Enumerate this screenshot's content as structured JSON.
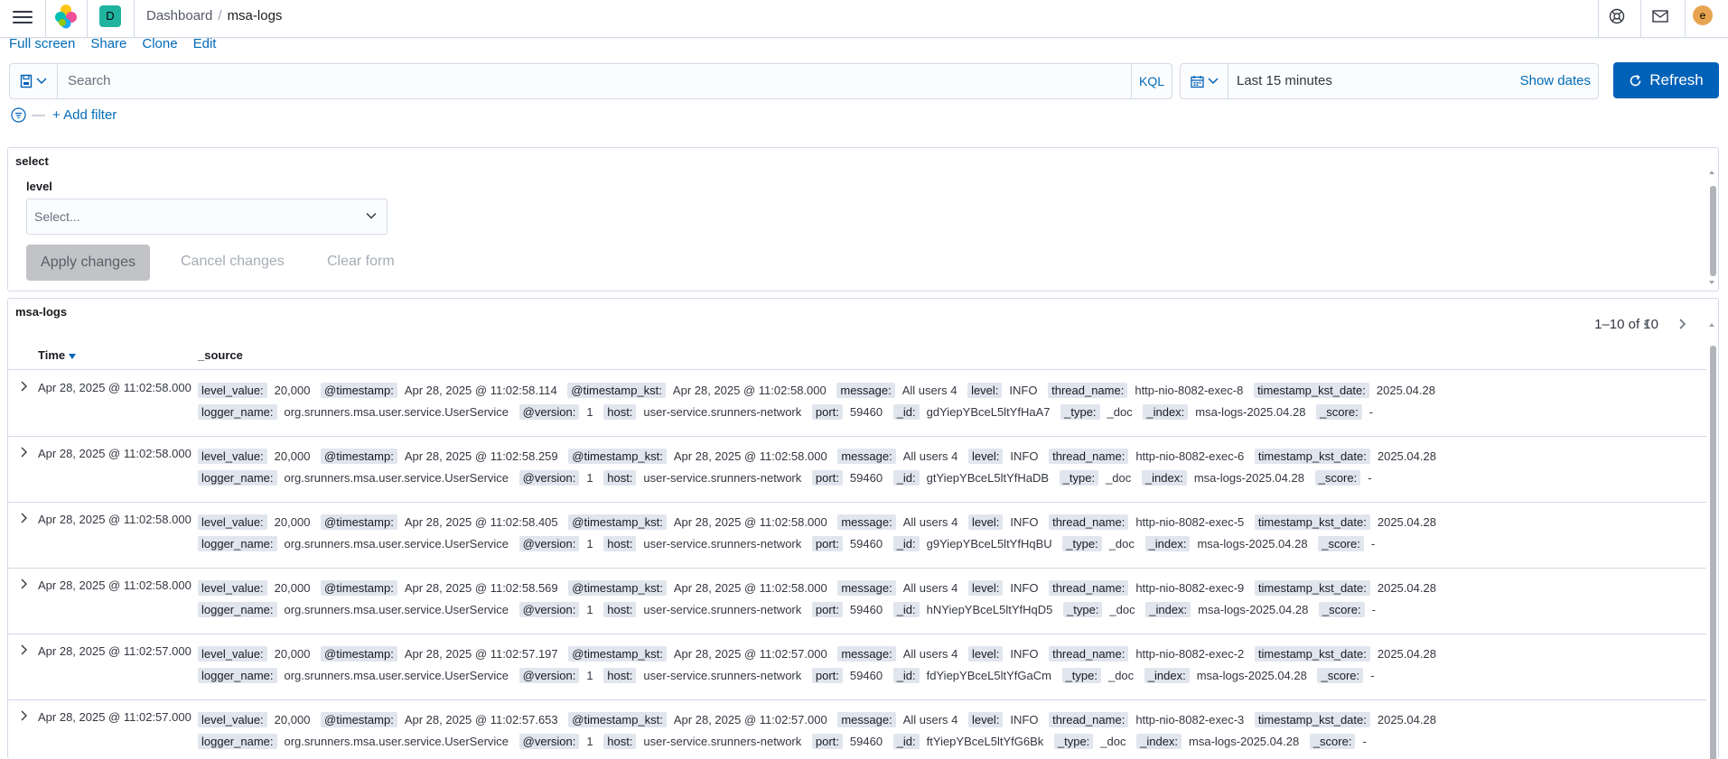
{
  "header": {
    "space_initial": "D",
    "breadcrumb_parent": "Dashboard",
    "breadcrumb_sep": "/",
    "breadcrumb_current": "msa-logs",
    "user_initial": "e"
  },
  "links": [
    "Full screen",
    "Share",
    "Clone",
    "Edit"
  ],
  "query": {
    "search_placeholder": "Search",
    "language": "KQL"
  },
  "time": {
    "range": "Last 15 minutes",
    "show_dates": "Show dates",
    "refresh_label": "Refresh"
  },
  "filter": {
    "add_filter": "+ Add filter"
  },
  "controls_panel": {
    "title": "select",
    "level_label": "level",
    "level_placeholder": "Select...",
    "apply": "Apply changes",
    "cancel": "Cancel changes",
    "clear": "Clear form"
  },
  "search_panel": {
    "title": "msa-logs",
    "pagination": "1–10 of 10",
    "col_time": "Time",
    "col_source": "_source",
    "rows": [
      {
        "time": "Apr 28, 2025 @ 11:02:58.000",
        "fields": [
          {
            "k": "level_value:",
            "v": "20,000"
          },
          {
            "k": "@timestamp:",
            "v": "Apr 28, 2025 @ 11:02:58.114"
          },
          {
            "k": "@timestamp_kst:",
            "v": "Apr 28, 2025 @ 11:02:58.000"
          },
          {
            "k": "message:",
            "v": "All users 4"
          },
          {
            "k": "level:",
            "v": "INFO"
          },
          {
            "k": "thread_name:",
            "v": "http-nio-8082-exec-8"
          },
          {
            "k": "timestamp_kst_date:",
            "v": "2025.04.28"
          },
          {
            "k": "logger_name:",
            "v": "org.srunners.msa.user.service.UserService"
          },
          {
            "k": "@version:",
            "v": "1"
          },
          {
            "k": "host:",
            "v": "user-service.srunners-network"
          },
          {
            "k": "port:",
            "v": "59460"
          },
          {
            "k": "_id:",
            "v": "gdYiepYBceL5ltYfHaA7"
          },
          {
            "k": "_type:",
            "v": "_doc"
          },
          {
            "k": "_index:",
            "v": "msa-logs-2025.04.28"
          },
          {
            "k": "_score:",
            "v": "-"
          }
        ]
      },
      {
        "time": "Apr 28, 2025 @ 11:02:58.000",
        "fields": [
          {
            "k": "level_value:",
            "v": "20,000"
          },
          {
            "k": "@timestamp:",
            "v": "Apr 28, 2025 @ 11:02:58.259"
          },
          {
            "k": "@timestamp_kst:",
            "v": "Apr 28, 2025 @ 11:02:58.000"
          },
          {
            "k": "message:",
            "v": "All users 4"
          },
          {
            "k": "level:",
            "v": "INFO"
          },
          {
            "k": "thread_name:",
            "v": "http-nio-8082-exec-6"
          },
          {
            "k": "timestamp_kst_date:",
            "v": "2025.04.28"
          },
          {
            "k": "logger_name:",
            "v": "org.srunners.msa.user.service.UserService"
          },
          {
            "k": "@version:",
            "v": "1"
          },
          {
            "k": "host:",
            "v": "user-service.srunners-network"
          },
          {
            "k": "port:",
            "v": "59460"
          },
          {
            "k": "_id:",
            "v": "gtYiepYBceL5ltYfHaDB"
          },
          {
            "k": "_type:",
            "v": "_doc"
          },
          {
            "k": "_index:",
            "v": "msa-logs-2025.04.28"
          },
          {
            "k": "_score:",
            "v": "-"
          }
        ]
      },
      {
        "time": "Apr 28, 2025 @ 11:02:58.000",
        "fields": [
          {
            "k": "level_value:",
            "v": "20,000"
          },
          {
            "k": "@timestamp:",
            "v": "Apr 28, 2025 @ 11:02:58.405"
          },
          {
            "k": "@timestamp_kst:",
            "v": "Apr 28, 2025 @ 11:02:58.000"
          },
          {
            "k": "message:",
            "v": "All users 4"
          },
          {
            "k": "level:",
            "v": "INFO"
          },
          {
            "k": "thread_name:",
            "v": "http-nio-8082-exec-5"
          },
          {
            "k": "timestamp_kst_date:",
            "v": "2025.04.28"
          },
          {
            "k": "logger_name:",
            "v": "org.srunners.msa.user.service.UserService"
          },
          {
            "k": "@version:",
            "v": "1"
          },
          {
            "k": "host:",
            "v": "user-service.srunners-network"
          },
          {
            "k": "port:",
            "v": "59460"
          },
          {
            "k": "_id:",
            "v": "g9YiepYBceL5ltYfHqBU"
          },
          {
            "k": "_type:",
            "v": "_doc"
          },
          {
            "k": "_index:",
            "v": "msa-logs-2025.04.28"
          },
          {
            "k": "_score:",
            "v": "-"
          }
        ]
      },
      {
        "time": "Apr 28, 2025 @ 11:02:58.000",
        "fields": [
          {
            "k": "level_value:",
            "v": "20,000"
          },
          {
            "k": "@timestamp:",
            "v": "Apr 28, 2025 @ 11:02:58.569"
          },
          {
            "k": "@timestamp_kst:",
            "v": "Apr 28, 2025 @ 11:02:58.000"
          },
          {
            "k": "message:",
            "v": "All users 4"
          },
          {
            "k": "level:",
            "v": "INFO"
          },
          {
            "k": "thread_name:",
            "v": "http-nio-8082-exec-9"
          },
          {
            "k": "timestamp_kst_date:",
            "v": "2025.04.28"
          },
          {
            "k": "logger_name:",
            "v": "org.srunners.msa.user.service.UserService"
          },
          {
            "k": "@version:",
            "v": "1"
          },
          {
            "k": "host:",
            "v": "user-service.srunners-network"
          },
          {
            "k": "port:",
            "v": "59460"
          },
          {
            "k": "_id:",
            "v": "hNYiepYBceL5ltYfHqD5"
          },
          {
            "k": "_type:",
            "v": "_doc"
          },
          {
            "k": "_index:",
            "v": "msa-logs-2025.04.28"
          },
          {
            "k": "_score:",
            "v": "-"
          }
        ]
      },
      {
        "time": "Apr 28, 2025 @ 11:02:57.000",
        "fields": [
          {
            "k": "level_value:",
            "v": "20,000"
          },
          {
            "k": "@timestamp:",
            "v": "Apr 28, 2025 @ 11:02:57.197"
          },
          {
            "k": "@timestamp_kst:",
            "v": "Apr 28, 2025 @ 11:02:57.000"
          },
          {
            "k": "message:",
            "v": "All users 4"
          },
          {
            "k": "level:",
            "v": "INFO"
          },
          {
            "k": "thread_name:",
            "v": "http-nio-8082-exec-2"
          },
          {
            "k": "timestamp_kst_date:",
            "v": "2025.04.28"
          },
          {
            "k": "logger_name:",
            "v": "org.srunners.msa.user.service.UserService"
          },
          {
            "k": "@version:",
            "v": "1"
          },
          {
            "k": "host:",
            "v": "user-service.srunners-network"
          },
          {
            "k": "port:",
            "v": "59460"
          },
          {
            "k": "_id:",
            "v": "fdYiepYBceL5ltYfGaCm"
          },
          {
            "k": "_type:",
            "v": "_doc"
          },
          {
            "k": "_index:",
            "v": "msa-logs-2025.04.28"
          },
          {
            "k": "_score:",
            "v": "-"
          }
        ]
      },
      {
        "time": "Apr 28, 2025 @ 11:02:57.000",
        "fields": [
          {
            "k": "level_value:",
            "v": "20,000"
          },
          {
            "k": "@timestamp:",
            "v": "Apr 28, 2025 @ 11:02:57.653"
          },
          {
            "k": "@timestamp_kst:",
            "v": "Apr 28, 2025 @ 11:02:57.000"
          },
          {
            "k": "message:",
            "v": "All users 4"
          },
          {
            "k": "level:",
            "v": "INFO"
          },
          {
            "k": "thread_name:",
            "v": "http-nio-8082-exec-3"
          },
          {
            "k": "timestamp_kst_date:",
            "v": "2025.04.28"
          },
          {
            "k": "logger_name:",
            "v": "org.srunners.msa.user.service.UserService"
          },
          {
            "k": "@version:",
            "v": "1"
          },
          {
            "k": "host:",
            "v": "user-service.srunners-network"
          },
          {
            "k": "port:",
            "v": "59460"
          },
          {
            "k": "_id:",
            "v": "ftYiepYBceL5ltYfG6Bk"
          },
          {
            "k": "_type:",
            "v": "_doc"
          },
          {
            "k": "_index:",
            "v": "msa-logs-2025.04.28"
          },
          {
            "k": "_score:",
            "v": "-"
          }
        ]
      }
    ]
  }
}
